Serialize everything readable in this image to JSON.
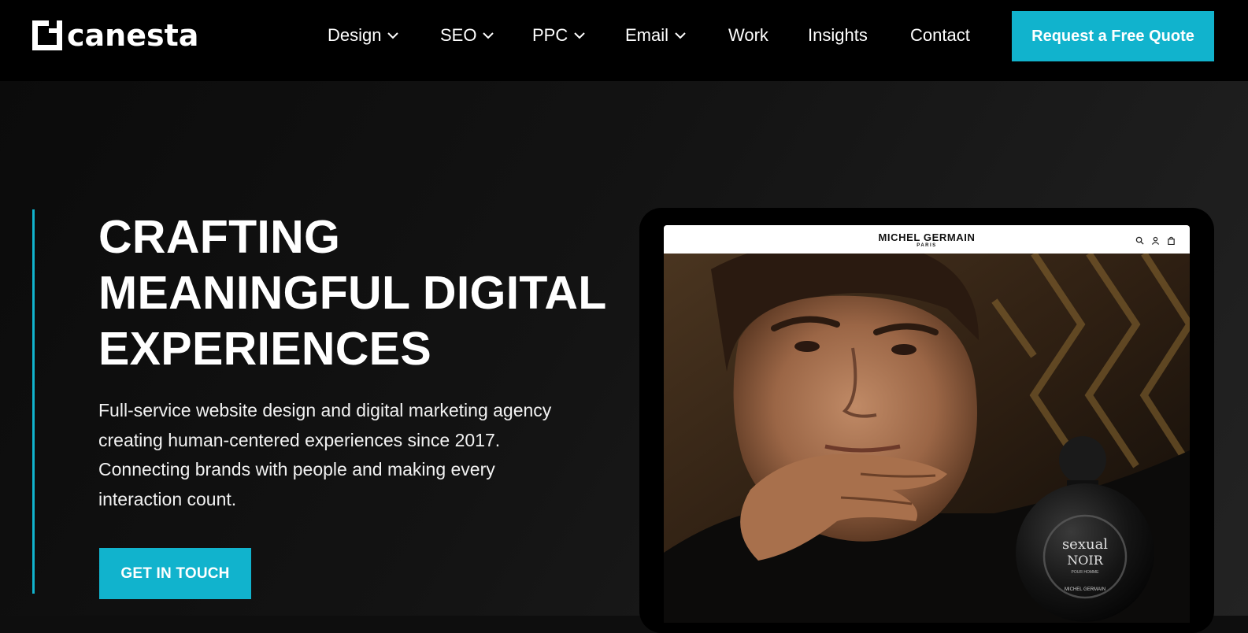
{
  "header": {
    "logo_text": "canesta",
    "nav": [
      {
        "label": "Design",
        "has_dropdown": true
      },
      {
        "label": "SEO",
        "has_dropdown": true
      },
      {
        "label": "PPC",
        "has_dropdown": true
      },
      {
        "label": "Email",
        "has_dropdown": true
      },
      {
        "label": "Work",
        "has_dropdown": false
      },
      {
        "label": "Insights",
        "has_dropdown": false
      },
      {
        "label": "Contact",
        "has_dropdown": false
      }
    ],
    "cta_label": "Request a Free Quote"
  },
  "hero": {
    "headline_lines": [
      "CRAFTING",
      "MEANINGFUL DIGITAL",
      "EXPERIENCES"
    ],
    "lead_lines": [
      "Full-service website design and digital marketing agency",
      "creating human-centered experiences since 2017.",
      "Connecting brands with people and making every",
      "interaction count."
    ],
    "cta_label": "GET IN TOUCH"
  },
  "mockup": {
    "brand_name": "MICHEL GERMAIN",
    "brand_city": "PARIS",
    "icons": [
      "search-icon",
      "user-icon",
      "bag-icon"
    ],
    "bottle_label_line1": "sexual",
    "bottle_label_line2": "NOIR",
    "bottle_label_line3": "POUR HOMME",
    "bottle_label_line4": "MICHEL GERMAIN"
  },
  "colors": {
    "accent": "#11b3cd",
    "header_bg": "#000000",
    "hero_bg": "#0e0e0e"
  }
}
